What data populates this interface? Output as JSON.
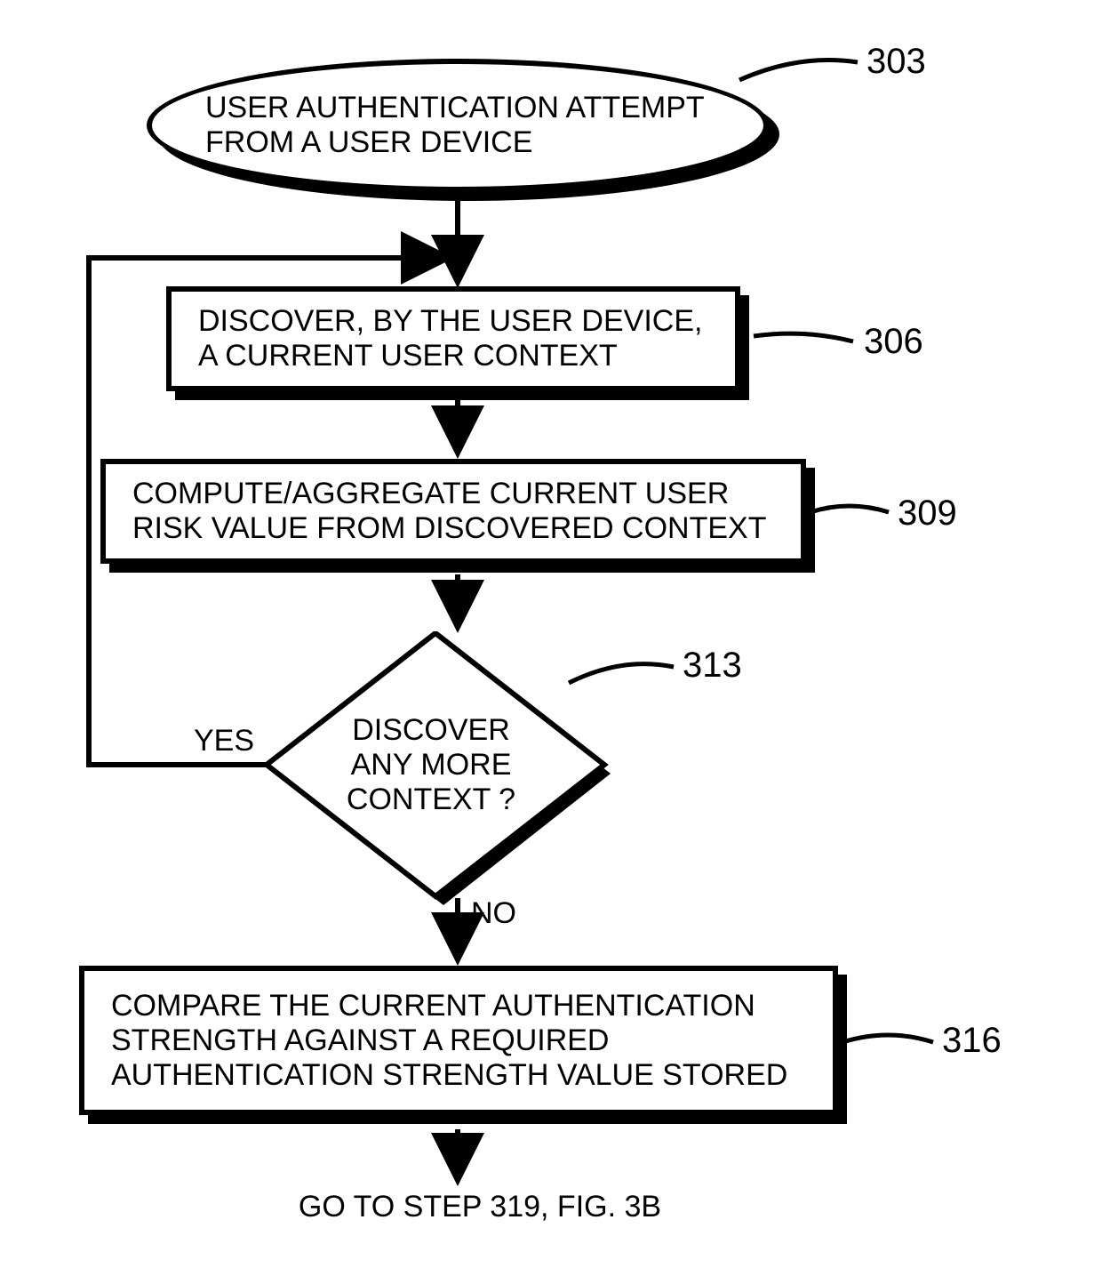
{
  "flowchart": {
    "start": {
      "text": "USER AUTHENTICATION ATTEMPT FROM A USER DEVICE",
      "ref": "303"
    },
    "step1": {
      "text": "DISCOVER, BY THE USER DEVICE, A CURRENT USER CONTEXT",
      "ref": "306"
    },
    "step2": {
      "text": "COMPUTE/AGGREGATE CURRENT USER RISK VALUE FROM DISCOVERED CONTEXT",
      "ref": "309"
    },
    "decision": {
      "text": "DISCOVER ANY MORE CONTEXT ?",
      "ref": "313",
      "yes": "YES",
      "no": "NO"
    },
    "step3": {
      "text": "COMPARE THE CURRENT AUTHENTICATION STRENGTH AGAINST A REQUIRED AUTHENTICATION STRENGTH VALUE STORED",
      "ref": "316"
    },
    "exit": "GO TO STEP 319, FIG. 3B"
  }
}
